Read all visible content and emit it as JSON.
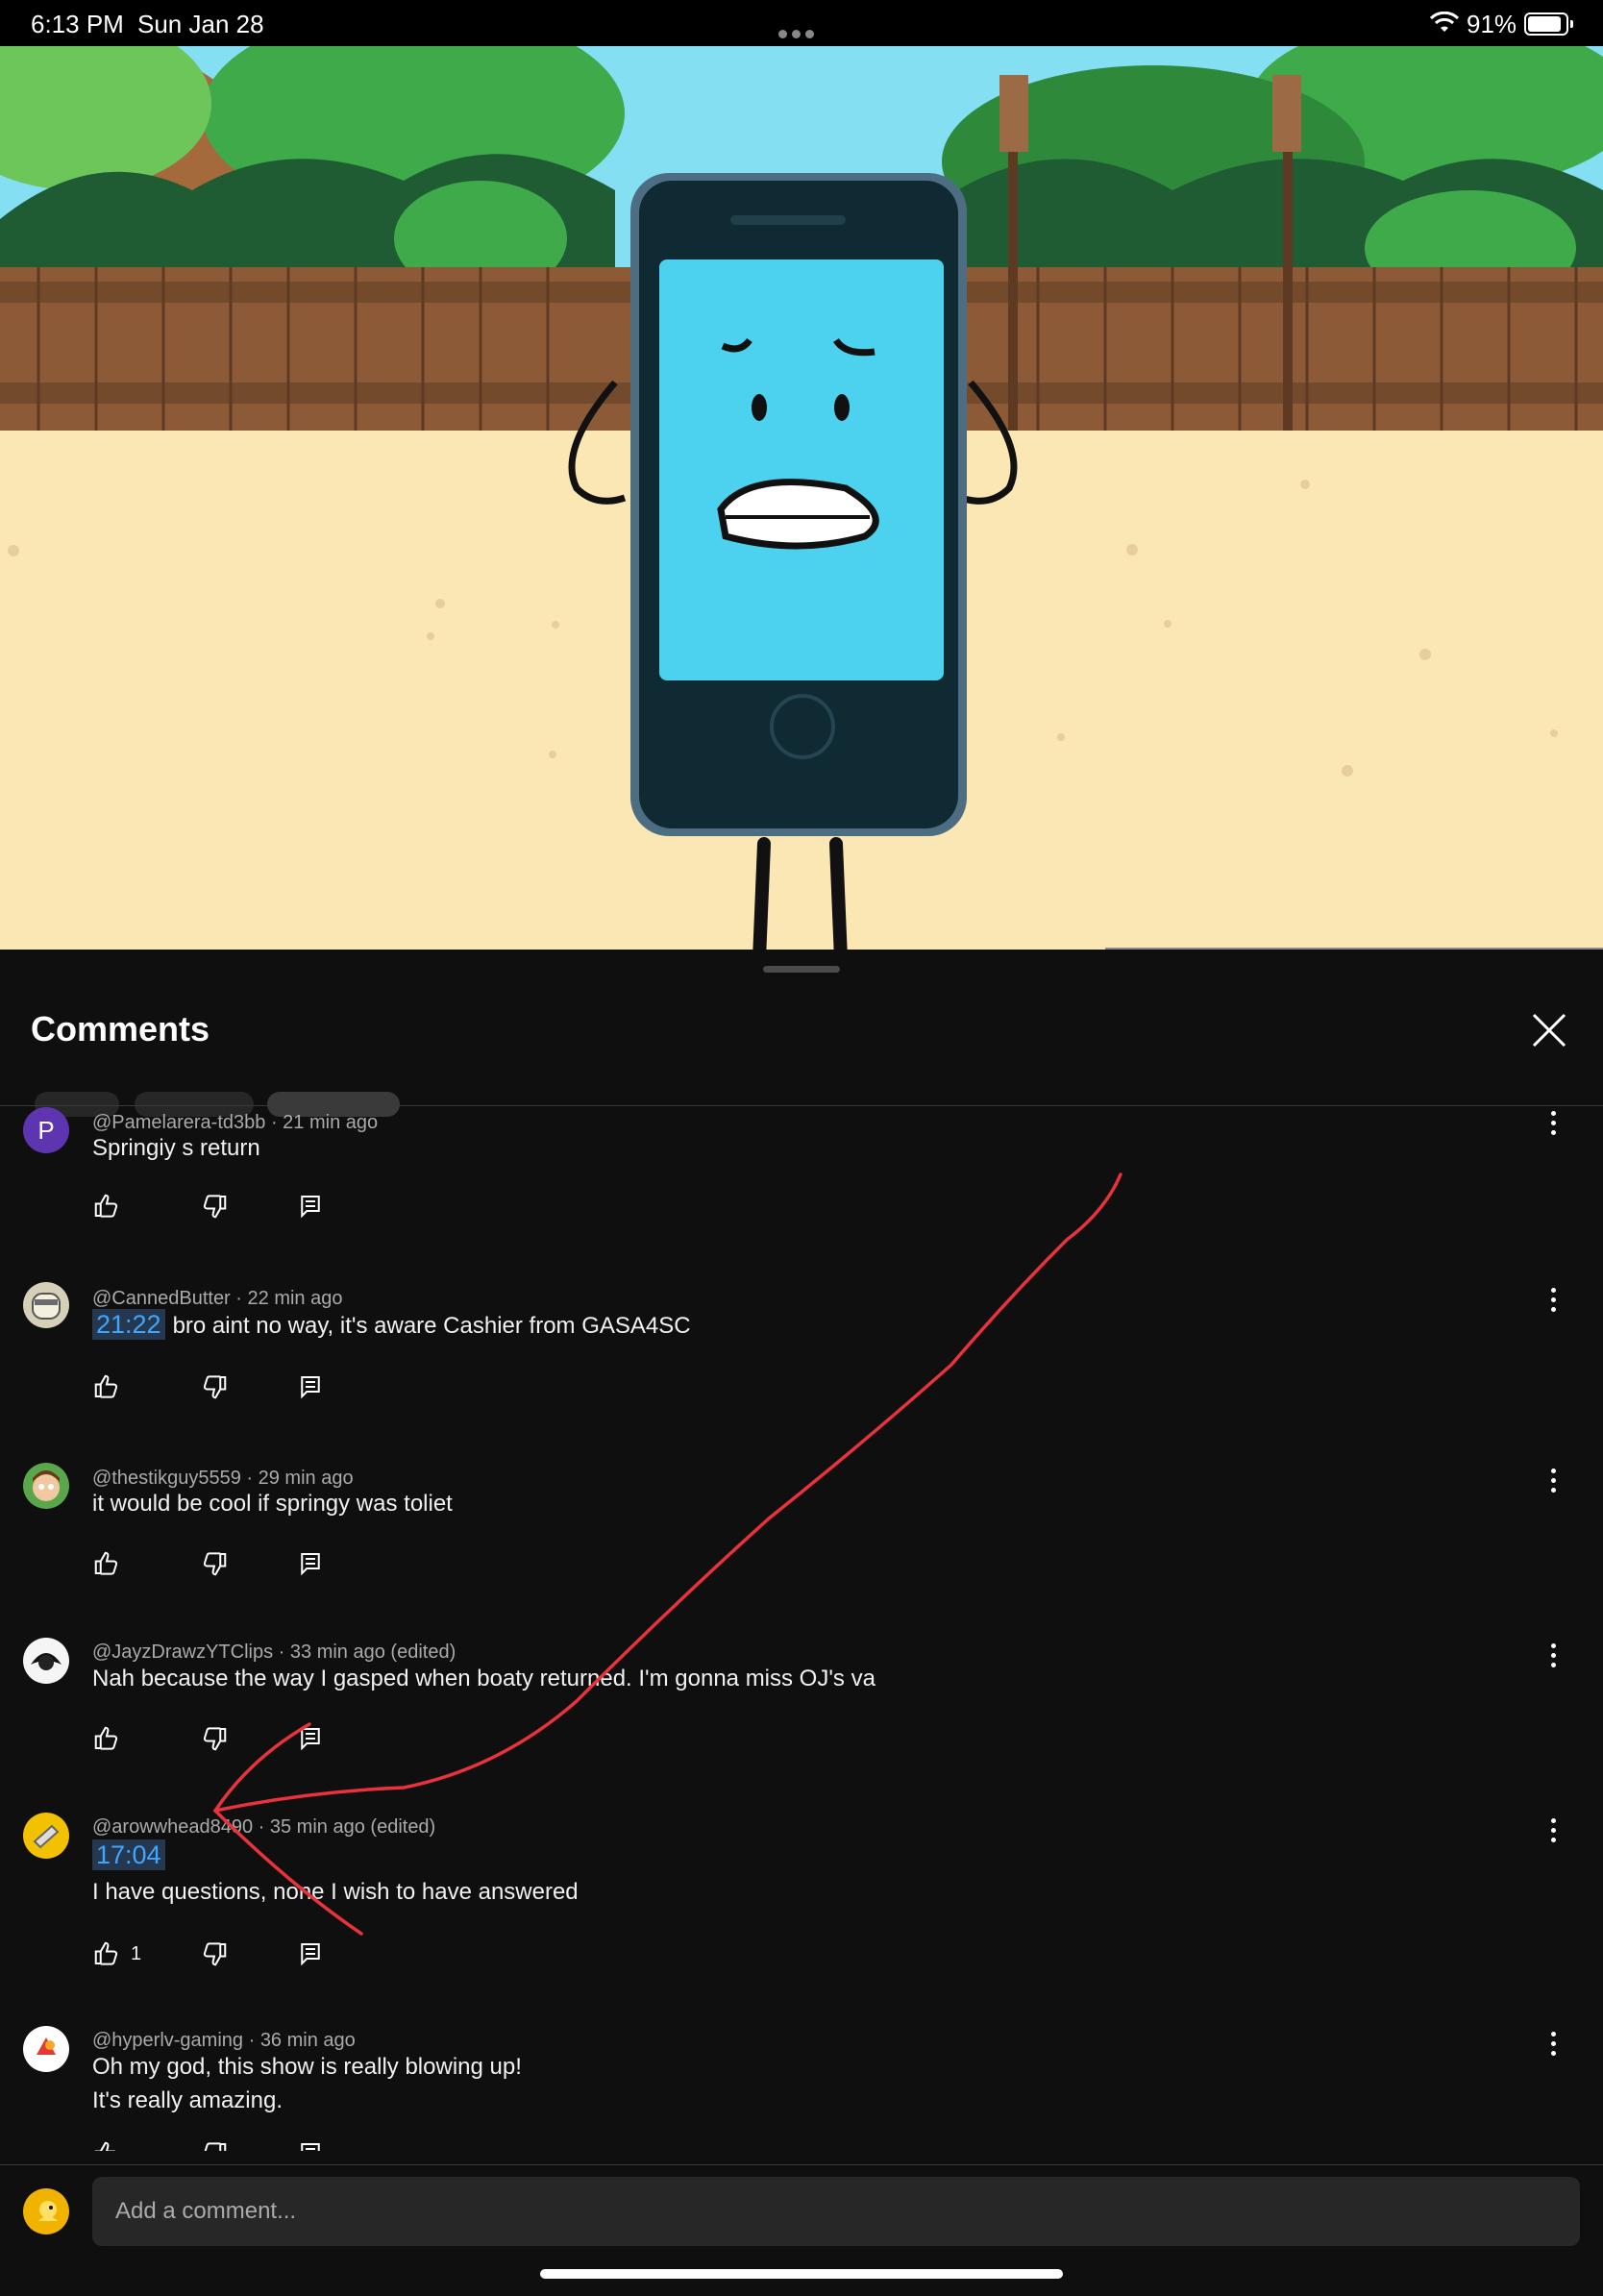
{
  "status_bar": {
    "time": "6:13 PM",
    "date": "Sun Jan 28",
    "battery": "91%"
  },
  "comments_panel": {
    "title": "Comments",
    "comments": [
      {
        "author": "@Pamelarera-td3bb",
        "age": "21 min ago",
        "edited": "",
        "timestamp": "",
        "text": "Springiy s return",
        "text2": "",
        "likes": "",
        "avatar_letter": "P"
      },
      {
        "author": "@CannedButter",
        "age": "22 min ago",
        "edited": "",
        "timestamp": "21:22",
        "text": "bro aint no way, it's aware Cashier from GASA4SC",
        "text2": "",
        "likes": ""
      },
      {
        "author": "@thestikguy5559",
        "age": "29 min ago",
        "edited": "",
        "timestamp": "",
        "text": "it would be cool if springy was toliet",
        "text2": "",
        "likes": ""
      },
      {
        "author": "@JayzDrawzYTClips",
        "age": "33 min ago",
        "edited": "(edited)",
        "timestamp": "",
        "text": "Nah because the way I gasped when boaty returned. I'm gonna miss OJ's va",
        "text2": "",
        "likes": ""
      },
      {
        "author": "@arowwhead8490",
        "age": "35 min ago",
        "edited": "(edited)",
        "timestamp": "17:04",
        "text": "I have questions, none I wish to have answered",
        "text2": "",
        "likes": "1"
      },
      {
        "author": "@hyperlv-gaming",
        "age": "36 min ago",
        "edited": "",
        "timestamp": "",
        "text": "Oh my god, this show is really blowing up!",
        "text2": "It's really amazing.",
        "likes": ""
      }
    ],
    "input_placeholder": "Add a comment..."
  },
  "icons": [
    "wifi-icon",
    "battery-icon",
    "close-icon",
    "like-icon",
    "dislike-icon",
    "reply-icon",
    "more-icon"
  ],
  "colors": {
    "background": "#0f0f0f",
    "timestamp_link": "#3ea6ff",
    "annotation": "#e8323c"
  }
}
